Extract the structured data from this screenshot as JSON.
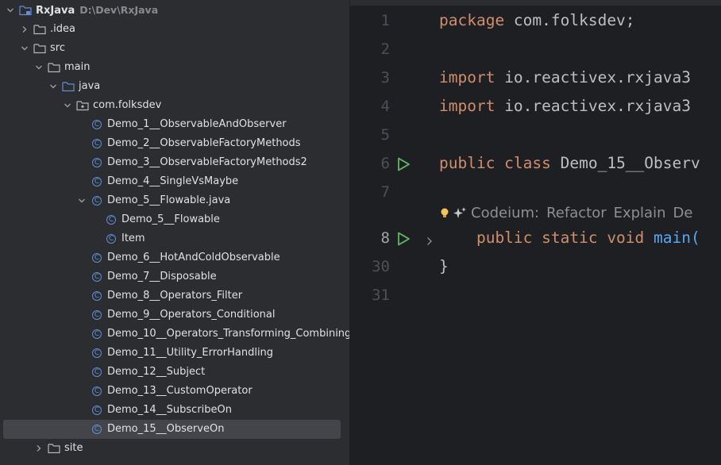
{
  "project": {
    "name": "RxJava",
    "path": "D:\\Dev\\RxJava"
  },
  "tree": [
    {
      "label": "RxJava",
      "icon": "project-folder-icon",
      "depth": 0,
      "arrow": "down"
    },
    {
      "label": ".idea",
      "icon": "folder-icon",
      "depth": 1,
      "arrow": "right"
    },
    {
      "label": "src",
      "icon": "folder-icon",
      "depth": 1,
      "arrow": "down"
    },
    {
      "label": "main",
      "icon": "folder-icon",
      "depth": 2,
      "arrow": "down"
    },
    {
      "label": "java",
      "icon": "source-folder-icon",
      "depth": 3,
      "arrow": "down"
    },
    {
      "label": "com.folksdev",
      "icon": "package-icon",
      "depth": 4,
      "arrow": "down"
    },
    {
      "label": "Demo_1__ObservableAndObserver",
      "icon": "class-icon",
      "depth": 5,
      "arrow": ""
    },
    {
      "label": "Demo_2__ObservableFactoryMethods",
      "icon": "class-icon",
      "depth": 5,
      "arrow": ""
    },
    {
      "label": "Demo_3__ObservableFactoryMethods2",
      "icon": "class-icon",
      "depth": 5,
      "arrow": ""
    },
    {
      "label": "Demo_4__SingleVsMaybe",
      "icon": "class-icon",
      "depth": 5,
      "arrow": ""
    },
    {
      "label": "Demo_5__Flowable.java",
      "icon": "class-icon",
      "depth": 5,
      "arrow": "down"
    },
    {
      "label": "Demo_5__Flowable",
      "icon": "class-icon",
      "depth": 6,
      "arrow": ""
    },
    {
      "label": "Item",
      "icon": "class-icon",
      "depth": 6,
      "arrow": ""
    },
    {
      "label": "Demo_6__HotAndColdObservable",
      "icon": "class-icon",
      "depth": 5,
      "arrow": ""
    },
    {
      "label": "Demo_7__Disposable",
      "icon": "class-icon",
      "depth": 5,
      "arrow": ""
    },
    {
      "label": "Demo_8__Operators_Filter",
      "icon": "class-icon",
      "depth": 5,
      "arrow": ""
    },
    {
      "label": "Demo_9__Operators_Conditional",
      "icon": "class-icon",
      "depth": 5,
      "arrow": ""
    },
    {
      "label": "Demo_10__Operators_Transforming_Combining",
      "icon": "class-icon",
      "depth": 5,
      "arrow": ""
    },
    {
      "label": "Demo_11__Utility_ErrorHandling",
      "icon": "class-icon",
      "depth": 5,
      "arrow": ""
    },
    {
      "label": "Demo_12__Subject",
      "icon": "class-icon",
      "depth": 5,
      "arrow": ""
    },
    {
      "label": "Demo_13__CustomOperator",
      "icon": "class-icon",
      "depth": 5,
      "arrow": ""
    },
    {
      "label": "Demo_14__SubscribeOn",
      "icon": "class-icon",
      "depth": 5,
      "arrow": ""
    },
    {
      "label": "Demo_15__ObserveOn",
      "icon": "class-icon",
      "depth": 5,
      "arrow": "",
      "selected": true
    },
    {
      "label": "site",
      "icon": "folder-icon",
      "depth": 2,
      "arrow": "right"
    }
  ],
  "editor": {
    "lines": [
      {
        "num": "1",
        "tokens": [
          {
            "t": "package ",
            "c": "kw"
          },
          {
            "t": "com.folksdev;",
            "c": ""
          }
        ]
      },
      {
        "num": "2",
        "tokens": []
      },
      {
        "num": "3",
        "tokens": [
          {
            "t": "import ",
            "c": "kw"
          },
          {
            "t": "io.reactivex.rxjava3",
            "c": ""
          }
        ]
      },
      {
        "num": "4",
        "tokens": [
          {
            "t": "import ",
            "c": "kw"
          },
          {
            "t": "io.reactivex.rxjava3",
            "c": ""
          }
        ]
      },
      {
        "num": "5",
        "tokens": []
      },
      {
        "num": "6",
        "tokens": [
          {
            "t": "public class ",
            "c": "kw"
          },
          {
            "t": "Demo_15__Observ",
            "c": ""
          }
        ],
        "run": true
      },
      {
        "num": "7",
        "tokens": []
      },
      {
        "num": "8",
        "tokens": [
          {
            "t": "    public static void ",
            "c": "kw"
          },
          {
            "t": "main(",
            "c": "fn"
          }
        ],
        "run": true,
        "fold": true,
        "current": true
      },
      {
        "num": "30",
        "tokens": [
          {
            "t": "}",
            "c": ""
          }
        ]
      },
      {
        "num": "31",
        "tokens": []
      }
    ],
    "codelens": [
      "Codeium:",
      "Refactor",
      "Explain",
      "De"
    ]
  },
  "colors": {
    "keyword": "#cf8e6d",
    "function": "#56a8f5",
    "text": "#bcbec4",
    "run": "#5fb865",
    "class_icon": "#5e8fd8"
  }
}
